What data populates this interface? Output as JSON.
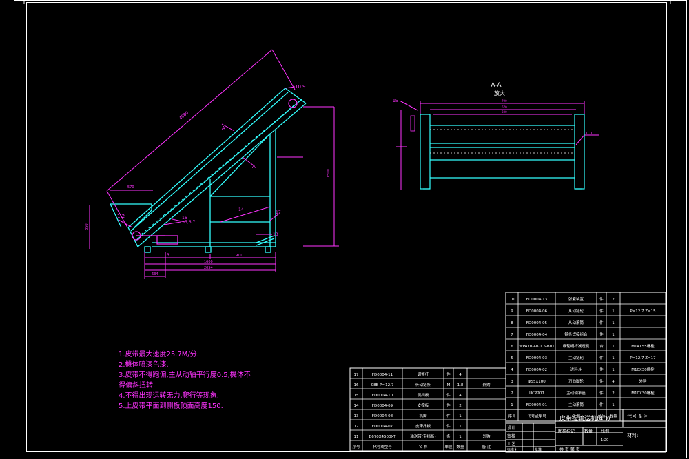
{
  "section_view": {
    "title": "A-A",
    "subtitle": "放大",
    "dim_top_1": "790",
    "dim_top_2": "670",
    "dim_top_3": "600",
    "dim_right": "1.10",
    "leader_left": "15"
  },
  "main_view": {
    "label_10_9": "10 9",
    "label_a_top": "A",
    "label_a_bottom": "A",
    "label_12": "1,2",
    "label_16": "16",
    "label_567": "5,6,7",
    "label_14": "14",
    "label_17": "17",
    "label_13": "13",
    "label_3": "3",
    "dim_slope": "4080",
    "dim_hopper": "570",
    "dim_height": "1500",
    "dim_left_h": "350",
    "dim_bottom_1": "911",
    "dim_bottom_2": "1600",
    "dim_bottom_3": "2054",
    "dim_bottom_4": "634"
  },
  "notes": [
    "1.皮带最大速度25.7M/分.",
    "2.機体喷漆色漆.",
    "3.皮带不得跑偏,主从动轴平行度0.5,機体不",
    "得偏斜扭转.",
    "4.不得出现运转无力,爬行等现象.",
    "5.上皮带平面到侧板顶面高度150."
  ],
  "bom_right": {
    "rows": [
      {
        "no": "10",
        "code": "FD0004-13",
        "name": "张紧装置",
        "unit": "件",
        "qty": "2",
        "note": ""
      },
      {
        "no": "9",
        "code": "FD0004-06",
        "name": "从动链轮",
        "unit": "件",
        "qty": "1",
        "note": "P=12.7 Z=15"
      },
      {
        "no": "8",
        "code": "FD0004-05",
        "name": "从动滚筒",
        "unit": "件",
        "qty": "1",
        "note": ""
      },
      {
        "no": "7",
        "code": "FD0004-04",
        "name": "链条焊接组合",
        "unit": "件",
        "qty": "1",
        "note": ""
      },
      {
        "no": "6",
        "code": "WPA70-40-1.5-B01",
        "name": "蜗轮蜗杆减速机",
        "unit": "台",
        "qty": "1",
        "note": "M14X55螺栓"
      },
      {
        "no": "5",
        "code": "FD0004-03",
        "name": "主动链轮",
        "unit": "件",
        "qty": "1",
        "note": "P=12.7 Z=17"
      },
      {
        "no": "4",
        "code": "FD0004-02",
        "name": "进料斗",
        "unit": "件",
        "qty": "1",
        "note": "M10X30螺栓"
      },
      {
        "no": "3",
        "code": "ΦS5X100",
        "name": "万向脚轮",
        "unit": "件",
        "qty": "4",
        "note": "外购"
      },
      {
        "no": "2",
        "code": "UCP207",
        "name": "主动轴承座",
        "unit": "件",
        "qty": "2",
        "note": "M10X30螺栓"
      },
      {
        "no": "1",
        "code": "FD0004-01",
        "name": "主动滚筒",
        "unit": "件",
        "qty": "1",
        "note": ""
      }
    ],
    "header": {
      "no": "序号",
      "code": "代号或型号",
      "name": "名 称",
      "unit": "单位",
      "qty": "数量",
      "note": "备 注"
    },
    "title": "皮带提输送机(4D)",
    "title_code": "代号",
    "labels": [
      "设计",
      "审核",
      "工艺",
      "标准化",
      "批准"
    ],
    "stage_label": "图样标记",
    "weight_label": "数量",
    "scale_label": "比例",
    "scale_value": "1:20",
    "sheet_label": "共 页 第 页",
    "material_label": "材料:"
  },
  "bom_left": {
    "rows": [
      {
        "no": "17",
        "code": "FD0004-11",
        "name": "调整杆",
        "unit": "件",
        "qty": "4",
        "note": ""
      },
      {
        "no": "16",
        "code": "08B P=12.7",
        "name": "传动链条",
        "unit": "M",
        "qty": "1.8",
        "note": "外购"
      },
      {
        "no": "15",
        "code": "FD0004-10",
        "name": "侧挡板",
        "unit": "件",
        "qty": "4",
        "note": ""
      },
      {
        "no": "14",
        "code": "FD0004-09",
        "name": "支撑板",
        "unit": "件",
        "qty": "2",
        "note": ""
      },
      {
        "no": "13",
        "code": "FD0004-08",
        "name": "机脚",
        "unit": "件",
        "qty": "1",
        "note": ""
      },
      {
        "no": "12",
        "code": "FD0004-07",
        "name": "皮带托板",
        "unit": "件",
        "qty": "1",
        "note": ""
      },
      {
        "no": "11",
        "code": "B670X4500XT",
        "name": "输送带(带挡板)",
        "unit": "条",
        "qty": "1",
        "note": "外购"
      }
    ],
    "header": {
      "no": "序号",
      "code": "代号或型号",
      "name": "名 称",
      "unit": "单位",
      "qty": "数量",
      "note": "备 注"
    }
  },
  "colors": {
    "background": "#000000",
    "frame": "#ffffff",
    "cyan": "#00ffff",
    "magenta": "#ff33ff",
    "green": "#33ff33",
    "yellow": "#ffff33"
  }
}
